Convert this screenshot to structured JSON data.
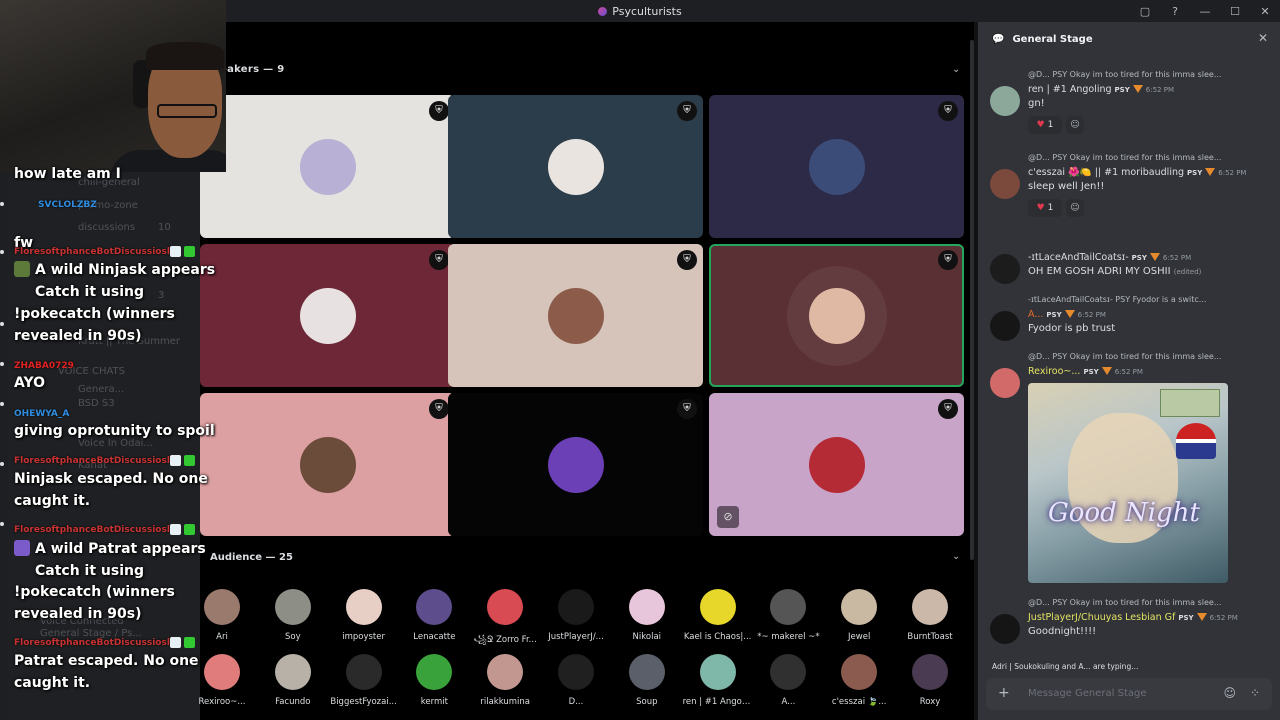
{
  "app": {
    "title": "Psyculturists"
  },
  "window_controls": [
    "▢",
    "?",
    "—",
    "☐",
    "✕"
  ],
  "channels": [
    "chill-general",
    "promo-zone",
    "discussions",
    "10",
    "3",
    "Kratt || The Summer",
    "VOICE CHATS",
    "Genera...",
    "BSD S3",
    "Voice In Odai...",
    "Kanat",
    "Voice Connected",
    "General Stage / Ps..."
  ],
  "overlay_chat": [
    {
      "type": "text",
      "text": "how late am I"
    },
    {
      "type": "user",
      "text": "SVCLOLZBZ"
    },
    {
      "type": "text",
      "text": "fw"
    },
    {
      "type": "user",
      "text": "FloresoftphanceBotDiscussiosla"
    },
    {
      "type": "text",
      "text": "A wild Ninjask appears"
    },
    {
      "type": "text",
      "text": "Catch it using"
    },
    {
      "type": "text",
      "text": "!pokecatch (winners"
    },
    {
      "type": "text",
      "text": "revealed in 90s)"
    },
    {
      "type": "user",
      "text": "ZHABA0729"
    },
    {
      "type": "text",
      "text": "AYO"
    },
    {
      "type": "user",
      "text": "OHEWYA_A"
    },
    {
      "type": "text",
      "text": "giving oprotunity to spoil"
    },
    {
      "type": "user",
      "text": "FloresoftphanceBotDiscussiosla"
    },
    {
      "type": "text",
      "text": "Ninjask escaped. No one"
    },
    {
      "type": "text",
      "text": "caught it."
    },
    {
      "type": "user",
      "text": "FloresoftphanceBotDiscussiosla"
    },
    {
      "type": "text",
      "text": "A wild Patrat appears"
    },
    {
      "type": "text",
      "text": "Catch it using"
    },
    {
      "type": "text",
      "text": "!pokecatch (winners"
    },
    {
      "type": "text",
      "text": "revealed in 90s)"
    },
    {
      "type": "user",
      "text": "FloresoftphanceBotDiscussiosla"
    },
    {
      "type": "text",
      "text": "Patrat escaped. No one"
    },
    {
      "type": "text",
      "text": "caught it."
    }
  ],
  "stage": {
    "speakers_label": "eakers — 9",
    "audience_label": "Audience — 25",
    "tiles": [
      {
        "bg": "#e4e3df",
        "avatar": "#b9b0d6"
      },
      {
        "bg": "#2b3c4a",
        "avatar": "#e9e4e0"
      },
      {
        "bg": "#2c2a46",
        "avatar": "#3b4c79"
      },
      {
        "bg": "#6e2737",
        "avatar": "#e7e1e1"
      },
      {
        "bg": "#d6c4ba",
        "avatar": "#8c5b4a"
      },
      {
        "bg": "#5a3035",
        "avatar": "#e0b9a5"
      },
      {
        "bg": "#dc9fa2",
        "avatar": "#6b4b3a"
      },
      {
        "bg": "#050505",
        "avatar": "#6b3fb5"
      },
      {
        "bg": "#c8a5c8",
        "avatar": "#b42a35"
      }
    ],
    "audience": [
      {
        "name": "Ari",
        "color": "#9b7a6e"
      },
      {
        "name": "Soy",
        "color": "#8d8f86"
      },
      {
        "name": "impoyster",
        "color": "#e8cfc5"
      },
      {
        "name": "Lenacatte",
        "color": "#5e4d8c"
      },
      {
        "name": "꧁Ջ Zorro Fr...",
        "color": "#d94b52"
      },
      {
        "name": "JustPlayerJ/...",
        "color": "#1a1a1a"
      },
      {
        "name": "Nikolai",
        "color": "#e7c5da"
      },
      {
        "name": "Kael is Chaos|...",
        "color": "#e6d72a"
      },
      {
        "name": "*~ makerel ~*",
        "color": "#555555"
      },
      {
        "name": "Jewel",
        "color": "#c9b9a2"
      },
      {
        "name": "BurntToast",
        "color": "#cbb8a9"
      },
      {
        "name": "Rexiroo~...",
        "color": "#e07c7c"
      },
      {
        "name": "Facundo",
        "color": "#b8b1a8"
      },
      {
        "name": "BiggestFyozai...",
        "color": "#2a2a2a"
      },
      {
        "name": "kermit",
        "color": "#3aa23a"
      },
      {
        "name": "rilakkumina",
        "color": "#c1978f"
      },
      {
        "name": "D...",
        "color": "#202020"
      },
      {
        "name": "Soup",
        "color": "#5a5f6a"
      },
      {
        "name": "ren | #1 Angoli...",
        "color": "#7fb8a8"
      },
      {
        "name": "A...",
        "color": "#303030"
      },
      {
        "name": "c'esszai 🍃...",
        "color": "#8a5b4e"
      },
      {
        "name": "Roxy",
        "color": "#4a3a52"
      }
    ]
  },
  "panel": {
    "title": "General Stage",
    "composer_placeholder": "Message General Stage",
    "typing": "Adri | Soukokuling and A... are typing...",
    "messages": [
      {
        "reply": "@D... PSY Okay im too tired for this imma slee...",
        "author": "ren | #1 Angoling",
        "author_color": "#dbdee1",
        "time": "6:52 PM",
        "body": "gn!",
        "react_count": "1",
        "avatar": "#8ca89b"
      },
      {
        "reply": "@D... PSY Okay im too tired for this imma slee...",
        "author": "c'esszai 🌺🍋 || #1 moribaudling",
        "author_color": "#dbdee1",
        "time": "6:52 PM",
        "body": "sleep well Jen!!",
        "react_count": "1",
        "avatar": "#7b4a3c"
      },
      {
        "reply": "",
        "author": "-ɪtLaceAndTailCoatsɪ-",
        "author_color": "#dbdee1",
        "time": "6:52 PM",
        "body": "OH EM GOSH ADRI MY OSHII",
        "edited": "(edited)",
        "avatar": "#1c1c1c"
      },
      {
        "reply": "-ɪtLaceAndTailCoatsɪ- PSY Fyodor is a switc...",
        "author": "A...",
        "author_color": "#e36b2a",
        "time": "6:52 PM",
        "body": "Fyodor is pb trust",
        "avatar": "#161616"
      },
      {
        "reply": "@D... PSY Okay im too tired for this imma slee...",
        "author": "Rexiroo~...",
        "author_color": "#e3e364",
        "time": "6:52 PM",
        "body": "",
        "avatar": "#d26a6a"
      },
      {
        "reply": "@D... PSY Okay im too tired for this imma slee...",
        "author": "JustPlayerJ/Chuuyas Lesbian Gf",
        "author_color": "#e3e364",
        "time": "6:52 PM",
        "body": "Goodnight!!!!",
        "avatar": "#151515"
      }
    ],
    "gif_text": "Good Night",
    "psy_tag": "PSY"
  }
}
